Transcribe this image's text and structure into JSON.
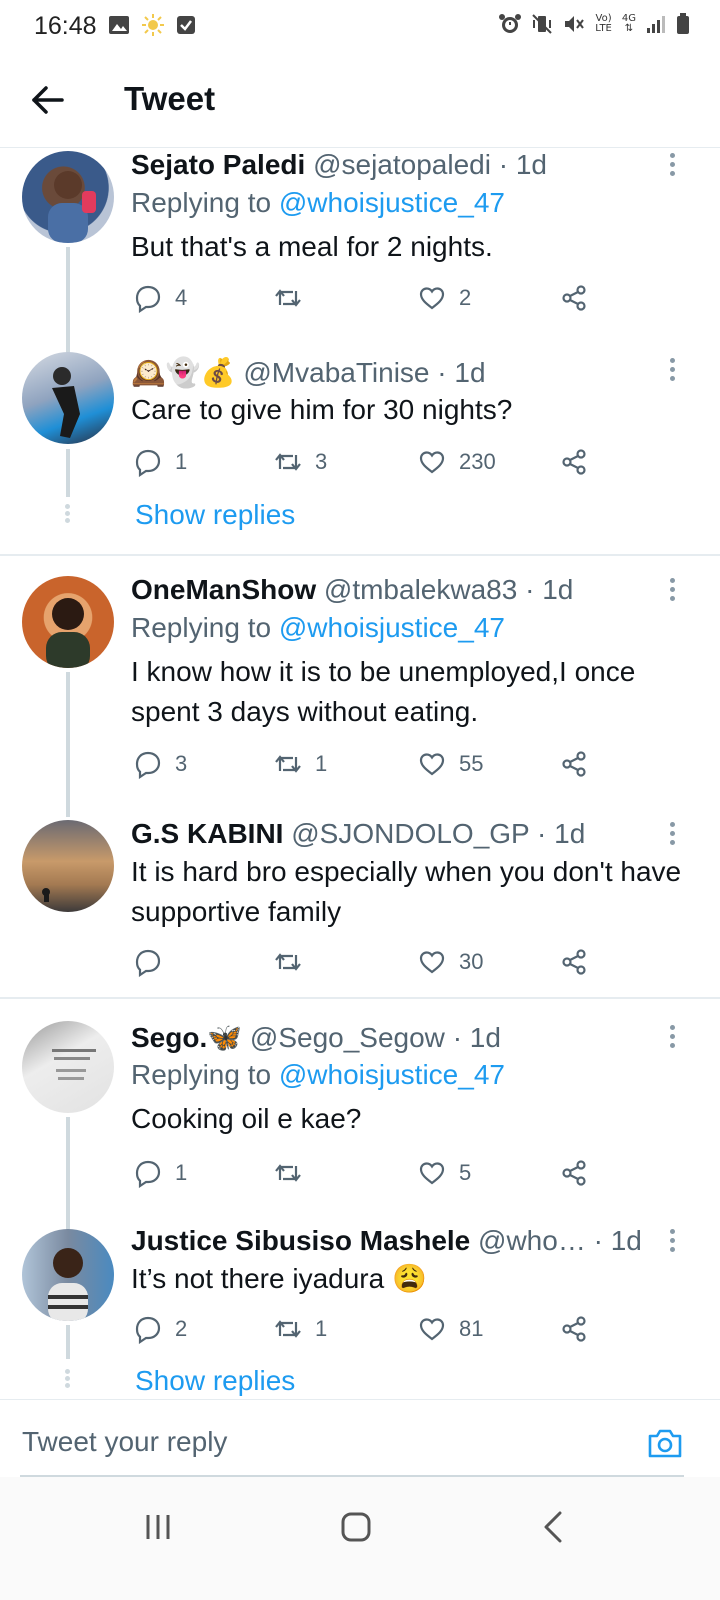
{
  "status_bar": {
    "time": "16:48",
    "volte": "Vo)",
    "lte": "LTE",
    "network": "4G"
  },
  "header": {
    "title": "Tweet"
  },
  "tweets": [
    {
      "name": "Sejato Paledi",
      "handle": "@sejatopaledi",
      "sep": "·",
      "time": "1d",
      "reply_prefix": "Replying to ",
      "reply_handle": "@whoisjustice_47",
      "text": "But that's a meal for 2 nights.",
      "replies": "4",
      "retweets": "",
      "likes": "2"
    },
    {
      "name": "🕰️👻💰",
      "handle": "@MvabaTinise",
      "sep": "·",
      "time": "1d",
      "text": "Care to give him for 30 nights?",
      "replies": "1",
      "retweets": "3",
      "likes": "230",
      "show_replies": "Show replies"
    },
    {
      "name": "OneManShow",
      "handle": "@tmbalekwa83",
      "sep": "·",
      "time": "1d",
      "reply_prefix": "Replying to ",
      "reply_handle": "@whoisjustice_47",
      "text": "I know how it is to be unemployed,I once spent 3 days without eating.",
      "replies": "3",
      "retweets": "1",
      "likes": "55"
    },
    {
      "name": "G.S KABINI",
      "handle": "@SJONDOLO_GP",
      "sep": "·",
      "time": "1d",
      "text": "It is hard bro especially when you don't have supportive family",
      "replies": "",
      "retweets": "",
      "likes": "30"
    },
    {
      "name": "Sego.🦋",
      "handle": "@Sego_Segow",
      "sep": "·",
      "time": "1d",
      "reply_prefix": "Replying to ",
      "reply_handle": "@whoisjustice_47",
      "text": "Cooking oil e kae?",
      "replies": "1",
      "retweets": "",
      "likes": "5"
    },
    {
      "name": "Justice Sibusiso Mashele",
      "handle": "@who…",
      "sep": "·",
      "time": "1d",
      "text": "It’s not there iyadura 😩",
      "replies": "2",
      "retweets": "1",
      "likes": "81",
      "show_replies": "Show replies"
    }
  ],
  "composer": {
    "placeholder": "Tweet your reply"
  },
  "colors": {
    "accent": "#1d9bf0",
    "text": "#0f1419",
    "muted": "#536471",
    "border": "#e6ecf0"
  }
}
